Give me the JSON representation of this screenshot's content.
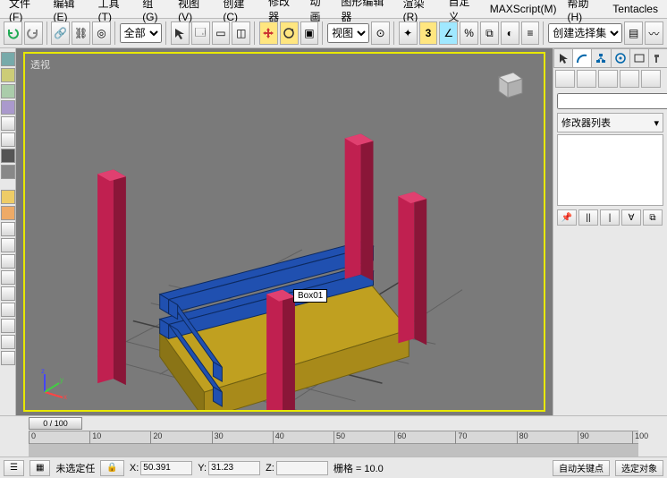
{
  "menu": {
    "items": [
      "文件(F)",
      "编辑(E)",
      "工具(T)",
      "组(G)",
      "视图(V)",
      "创建(C)",
      "修改器",
      "动画",
      "图形编辑器",
      "渲染(R)",
      "自定义",
      "MAXScript(M)",
      "帮助(H)",
      "Tentacles"
    ]
  },
  "top_toolbar": {
    "scope_dd": "全部",
    "view_dd": "视图",
    "create_sel_set": "创建选择集"
  },
  "viewport": {
    "label": "透视",
    "object_label": "Box01"
  },
  "right_panel": {
    "name_field": "",
    "mod_list_label": "修改器列表"
  },
  "timeline": {
    "slider_label": "0 / 100",
    "ticks": [
      "0",
      "10",
      "20",
      "30",
      "40",
      "50",
      "60",
      "70",
      "80",
      "90",
      "100"
    ]
  },
  "status": {
    "sel_label": "未选定任",
    "x_label": "X:",
    "x_val": "50.391",
    "y_label": "Y:",
    "y_val": "31.23",
    "z_label": "Z:",
    "z_val": "",
    "grid_label": "栅格 = 10.0",
    "autokey": "自动关键点",
    "setkey": "选定对象"
  }
}
